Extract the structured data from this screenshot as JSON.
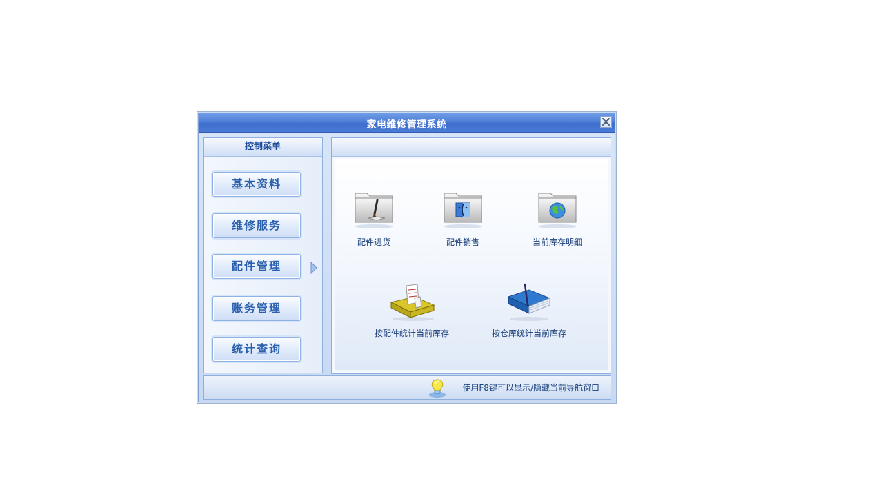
{
  "window": {
    "title": "家电维修管理系统"
  },
  "sidebar": {
    "title": "控制菜单",
    "items": [
      {
        "label": "基本资料"
      },
      {
        "label": "维修服务"
      },
      {
        "label": "配件管理",
        "selected": true
      },
      {
        "label": "账务管理"
      },
      {
        "label": "统计查询"
      }
    ]
  },
  "main": {
    "items": [
      {
        "label": "配件进货",
        "icon": "folder-brush-icon"
      },
      {
        "label": "配件销售",
        "icon": "folder-finder-icon"
      },
      {
        "label": "当前库存明细",
        "icon": "folder-globe-icon"
      },
      {
        "label": "按配件统计当前库存",
        "icon": "yellow-binder-icon"
      },
      {
        "label": "按仓库统计当前库存",
        "icon": "blue-book-icon"
      }
    ]
  },
  "footer": {
    "tip": "使用F8键可以显示/隐藏当前导航窗口",
    "icon": "lightbulb-icon"
  }
}
